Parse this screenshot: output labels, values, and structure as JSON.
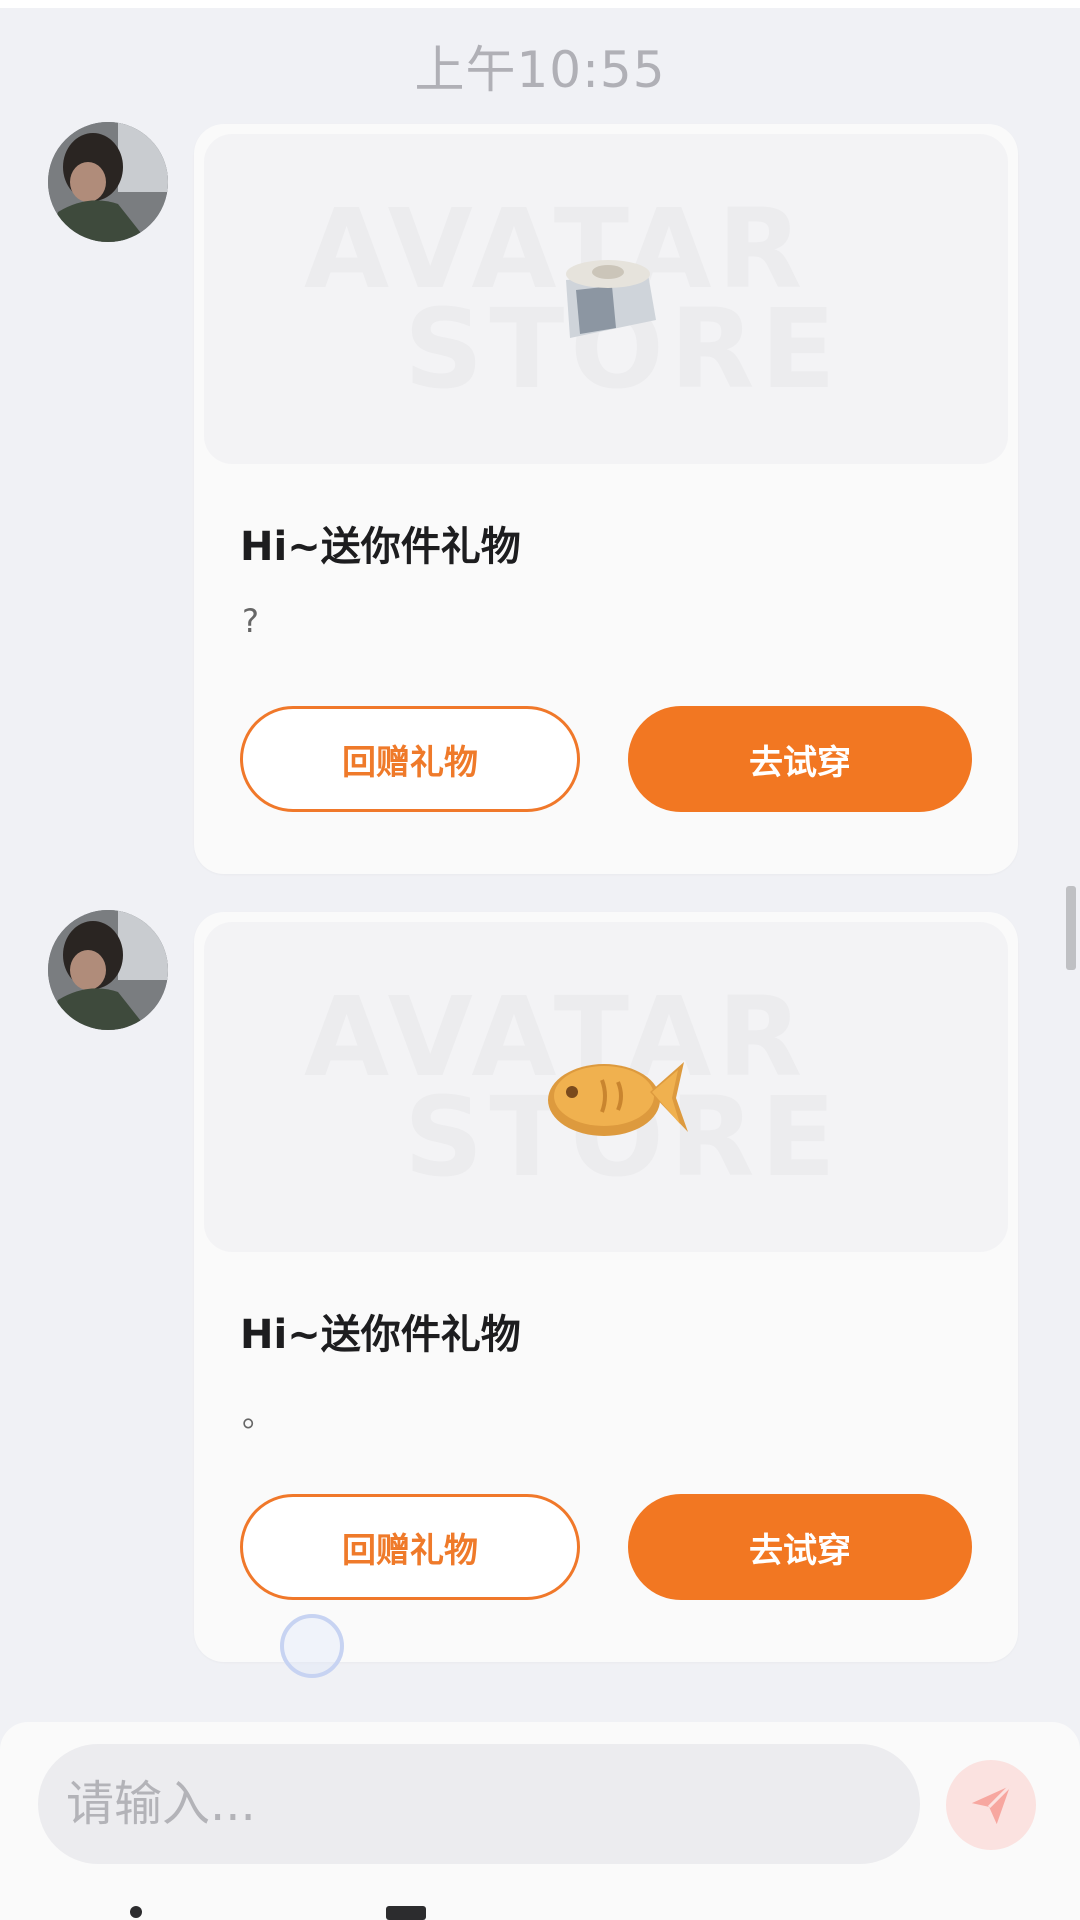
{
  "timestamp": "上午10:55",
  "watermark": {
    "line1": "AVATAR",
    "line2": "STORE"
  },
  "messages": [
    {
      "avatar_icon": "user-avatar",
      "gift_icon": "hat-gift-icon",
      "title": "Hi~送你件礼物",
      "subtitle": "?",
      "return_gift_label": "回赠礼物",
      "try_on_label": "去试穿"
    },
    {
      "avatar_icon": "user-avatar",
      "gift_icon": "fish-cookie-gift-icon",
      "title": "Hi~送你件礼物",
      "subtitle": "。",
      "return_gift_label": "回赠礼物",
      "try_on_label": "去试穿"
    }
  ],
  "composer": {
    "placeholder": "请输入...",
    "send_icon": "send-icon"
  },
  "colors": {
    "accent": "#f27722",
    "background": "#f0f1f5",
    "card": "#fafafa"
  }
}
